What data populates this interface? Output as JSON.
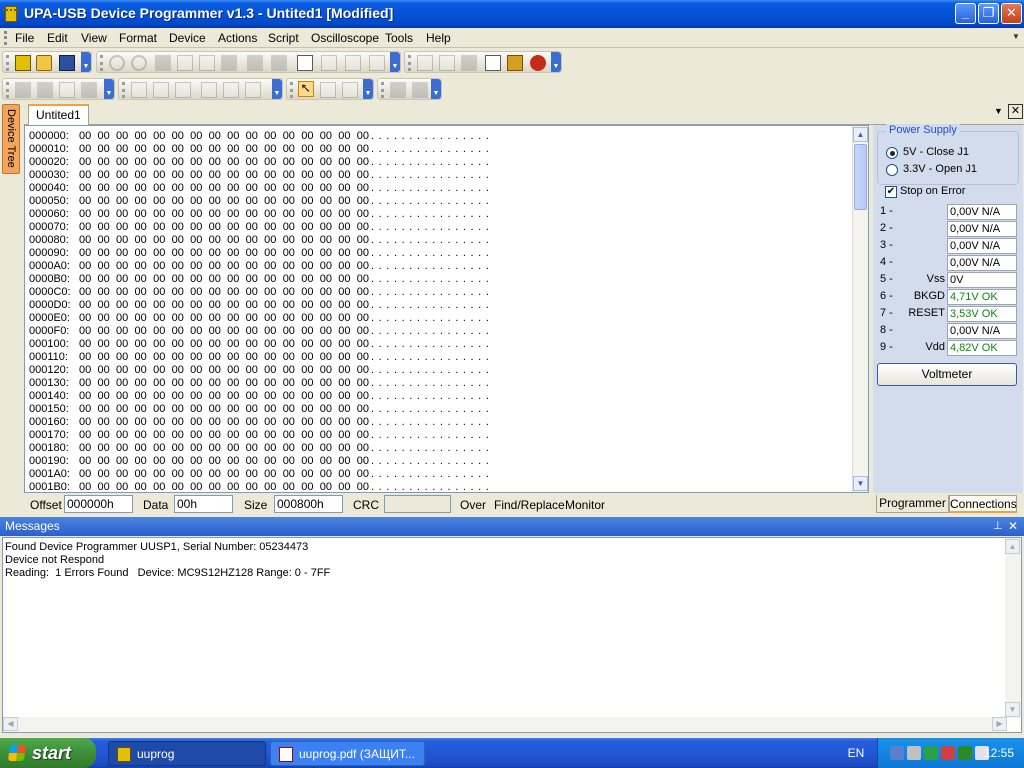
{
  "window": {
    "title": "UPA-USB Device Programmer v1.3 - Untited1 [Modified]",
    "min_glyph": "_",
    "max_glyph": "❐",
    "close_glyph": "✕",
    "icon": "chip-icon"
  },
  "menu": {
    "items": [
      "File",
      "Edit",
      "View",
      "Format",
      "Device",
      "Actions",
      "Script",
      "Oscilloscope",
      "Tools",
      "Help"
    ]
  },
  "toolbar_icons": {
    "file": [
      "chip-icon",
      "open-folder-icon",
      "save-icon"
    ],
    "edit": [
      "undo-icon",
      "redo-icon",
      "cut-icon",
      "copy-icon",
      "paste-icon",
      "delete-icon",
      "find-icon",
      "replace-icon",
      "page-icon",
      "grid-icon",
      "columns-icon",
      "refresh-icon"
    ],
    "device": [
      "read-icon",
      "write-icon",
      "grid-dots-icon",
      "verify-icon",
      "tool-icon",
      "bug-icon"
    ],
    "format": [
      "bold-icon",
      "italic-icon",
      "underline-icon",
      "align-left-icon",
      "align-center-icon",
      "align-right-icon"
    ],
    "scope": [
      "pointer-icon",
      "zoom-icon",
      "measure-icon",
      "play-icon",
      "stop-icon"
    ]
  },
  "side_tab": {
    "device_tree": "Device Tree"
  },
  "document": {
    "tab": "Untited1",
    "dropdown_glyph": "▼",
    "close_glyph": "✕"
  },
  "hex": {
    "rows": [
      {
        "addr": "000000:",
        "bytes": "00 00 00 00 00 00 00 00 00 00 00 00 00 00 00 00",
        "ascii": "................"
      },
      {
        "addr": "000010:",
        "bytes": "00 00 00 00 00 00 00 00 00 00 00 00 00 00 00 00",
        "ascii": "................"
      },
      {
        "addr": "000020:",
        "bytes": "00 00 00 00 00 00 00 00 00 00 00 00 00 00 00 00",
        "ascii": "................"
      },
      {
        "addr": "000030:",
        "bytes": "00 00 00 00 00 00 00 00 00 00 00 00 00 00 00 00",
        "ascii": "................"
      },
      {
        "addr": "000040:",
        "bytes": "00 00 00 00 00 00 00 00 00 00 00 00 00 00 00 00",
        "ascii": "................"
      },
      {
        "addr": "000050:",
        "bytes": "00 00 00 00 00 00 00 00 00 00 00 00 00 00 00 00",
        "ascii": "................"
      },
      {
        "addr": "000060:",
        "bytes": "00 00 00 00 00 00 00 00 00 00 00 00 00 00 00 00",
        "ascii": "................"
      },
      {
        "addr": "000070:",
        "bytes": "00 00 00 00 00 00 00 00 00 00 00 00 00 00 00 00",
        "ascii": "................"
      },
      {
        "addr": "000080:",
        "bytes": "00 00 00 00 00 00 00 00 00 00 00 00 00 00 00 00",
        "ascii": "................"
      },
      {
        "addr": "000090:",
        "bytes": "00 00 00 00 00 00 00 00 00 00 00 00 00 00 00 00",
        "ascii": "................"
      },
      {
        "addr": "0000A0:",
        "bytes": "00 00 00 00 00 00 00 00 00 00 00 00 00 00 00 00",
        "ascii": "................"
      },
      {
        "addr": "0000B0:",
        "bytes": "00 00 00 00 00 00 00 00 00 00 00 00 00 00 00 00",
        "ascii": "................"
      },
      {
        "addr": "0000C0:",
        "bytes": "00 00 00 00 00 00 00 00 00 00 00 00 00 00 00 00",
        "ascii": "................"
      },
      {
        "addr": "0000D0:",
        "bytes": "00 00 00 00 00 00 00 00 00 00 00 00 00 00 00 00",
        "ascii": "................"
      },
      {
        "addr": "0000E0:",
        "bytes": "00 00 00 00 00 00 00 00 00 00 00 00 00 00 00 00",
        "ascii": "................"
      },
      {
        "addr": "0000F0:",
        "bytes": "00 00 00 00 00 00 00 00 00 00 00 00 00 00 00 00",
        "ascii": "................"
      },
      {
        "addr": "000100:",
        "bytes": "00 00 00 00 00 00 00 00 00 00 00 00 00 00 00 00",
        "ascii": "................"
      },
      {
        "addr": "000110:",
        "bytes": "00 00 00 00 00 00 00 00 00 00 00 00 00 00 00 00",
        "ascii": "................"
      },
      {
        "addr": "000120:",
        "bytes": "00 00 00 00 00 00 00 00 00 00 00 00 00 00 00 00",
        "ascii": "................"
      },
      {
        "addr": "000130:",
        "bytes": "00 00 00 00 00 00 00 00 00 00 00 00 00 00 00 00",
        "ascii": "................"
      },
      {
        "addr": "000140:",
        "bytes": "00 00 00 00 00 00 00 00 00 00 00 00 00 00 00 00",
        "ascii": "................"
      },
      {
        "addr": "000150:",
        "bytes": "00 00 00 00 00 00 00 00 00 00 00 00 00 00 00 00",
        "ascii": "................"
      },
      {
        "addr": "000160:",
        "bytes": "00 00 00 00 00 00 00 00 00 00 00 00 00 00 00 00",
        "ascii": "................"
      },
      {
        "addr": "000170:",
        "bytes": "00 00 00 00 00 00 00 00 00 00 00 00 00 00 00 00",
        "ascii": "................"
      },
      {
        "addr": "000180:",
        "bytes": "00 00 00 00 00 00 00 00 00 00 00 00 00 00 00 00",
        "ascii": "................"
      },
      {
        "addr": "000190:",
        "bytes": "00 00 00 00 00 00 00 00 00 00 00 00 00 00 00 00",
        "ascii": "................"
      },
      {
        "addr": "0001A0:",
        "bytes": "00 00 00 00 00 00 00 00 00 00 00 00 00 00 00 00",
        "ascii": "................"
      },
      {
        "addr": "0001B0:",
        "bytes": "00 00 00 00 00 00 00 00 00 00 00 00 00 00 00 00",
        "ascii": "................"
      }
    ],
    "scroll_up_glyph": "▲",
    "scroll_down_glyph": "▼"
  },
  "status": {
    "offset_label": "Offset",
    "offset_value": "000000h",
    "data_label": "Data",
    "data_value": "00h",
    "size_label": "Size",
    "size_value": "000800h",
    "crc_label": "CRC",
    "crc_value": "",
    "over": "Over",
    "find_replace": "Find/Replace",
    "monitor": "Monitor"
  },
  "power": {
    "title": "Power Supply",
    "opt_5v": "5V - Close J1",
    "opt_33v": "3.3V - Open J1",
    "selected": "5V - Close J1",
    "stop_on_error": "Stop on Error",
    "stop_checked_glyph": "✔"
  },
  "pins": [
    {
      "num": "1 -",
      "name": "",
      "value": "0,00V  N/A",
      "ok": false
    },
    {
      "num": "2 -",
      "name": "",
      "value": "0,00V  N/A",
      "ok": false
    },
    {
      "num": "3 -",
      "name": "",
      "value": "0,00V  N/A",
      "ok": false
    },
    {
      "num": "4 -",
      "name": "",
      "value": "0,00V  N/A",
      "ok": false
    },
    {
      "num": "5 -",
      "name": "Vss",
      "value": "0V",
      "ok": false
    },
    {
      "num": "6 -",
      "name": "BKGD",
      "value": "4,71V  OK",
      "ok": true
    },
    {
      "num": "7 -",
      "name": "RESET",
      "value": "3,53V  OK",
      "ok": true
    },
    {
      "num": "8 -",
      "name": "",
      "value": "0,00V  N/A",
      "ok": false
    },
    {
      "num": "9 -",
      "name": "Vdd",
      "value": "4,82V  OK",
      "ok": true
    }
  ],
  "voltmeter": "Voltmeter",
  "right_tabs": {
    "programmer": "Programmer",
    "connections": "Connections"
  },
  "messages": {
    "title": "Messages",
    "pin_glyph": "📌",
    "close_glyph": "✕",
    "lines": [
      "Found Device Programmer UUSP1, Serial Number: 05234473",
      "Device not Respond",
      "Reading:  1 Errors Found   Device: MC9S12HZ128 Range: 0 - 7FF"
    ],
    "scroll_up_glyph": "▲",
    "scroll_down_glyph": "▼",
    "scroll_left_glyph": "◀",
    "scroll_right_glyph": "▶"
  },
  "taskbar": {
    "start": "start",
    "tasks": [
      {
        "label": "uuprog",
        "icon": "chip-icon"
      },
      {
        "label": "uuprog.pdf (ЗАЩИТ...",
        "icon": "pdf-icon"
      }
    ],
    "lang": "EN",
    "clock": "12:55",
    "tray_icons": [
      "network-icon",
      "sound-icon",
      "usb-icon",
      "shield-icon",
      "update-icon",
      "monitor-icon"
    ]
  },
  "colors": {
    "title_blue": "#0654d6",
    "ok_green": "#0a8a0a",
    "panel_blue": "#d2dcec",
    "tab_accent": "#f0a14a"
  }
}
